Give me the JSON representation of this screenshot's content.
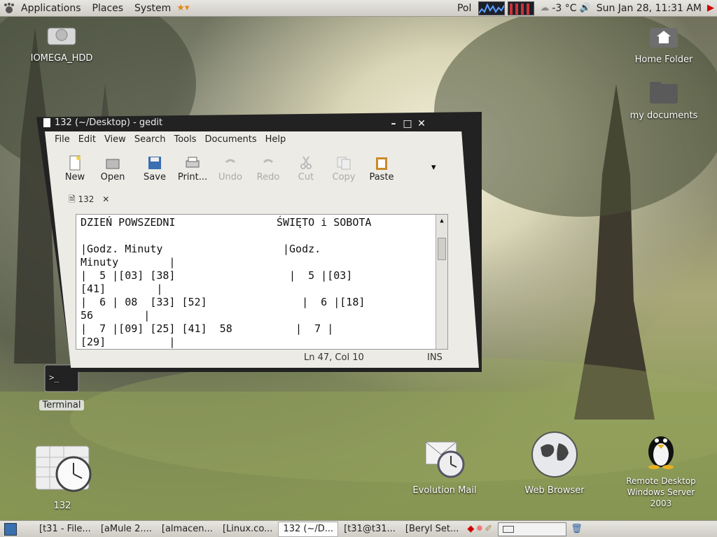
{
  "top_panel": {
    "menus": [
      "Applications",
      "Places",
      "System"
    ],
    "keyboard_layout": "Pol",
    "weather": "-3 °C",
    "clock": "Sun Jan 28, 11:31 AM"
  },
  "desktop_icons": {
    "iomega": "IOMEGA_HDD",
    "home": "Home Folder",
    "mydocs": "my documents",
    "terminal": "Terminal",
    "calendar": "132",
    "evolution": "Evolution Mail",
    "browser": "Web Browser",
    "rdp": "Remote Desktop Windows Server 2003"
  },
  "gedit": {
    "title": "132 (~/Desktop) - gedit",
    "menu": [
      "File",
      "Edit",
      "View",
      "Search",
      "Tools",
      "Documents",
      "Help"
    ],
    "toolbar": {
      "new": "New",
      "open": "Open",
      "save": "Save",
      "print": "Print...",
      "undo": "Undo",
      "redo": "Redo",
      "cut": "Cut",
      "copy": "Copy",
      "paste": "Paste"
    },
    "tab": "132",
    "content": "DZIEŃ POWSZEDNI                ŚWIĘTO i SOBOTA\n\n|Godz. Minuty                   |Godz.\nMinuty        |\n|  5 |[03] [38]                  |  5 |[03]\n[41]        |\n|  6 | 08  [33] [52]               |  6 |[18]\n56        |\n|  7 |[09] [25] [41]  58          |  7 |\n[29]          |",
    "status_pos": "Ln 47, Col 10",
    "status_mode": "INS"
  },
  "taskbar": {
    "tasks": [
      "[t31 - File...",
      "[aMule 2....",
      "[almacen...",
      "[Linux.co...",
      "132 (~/D...",
      "[t31@t31...",
      "[Beryl Set..."
    ]
  },
  "colors": {
    "panel": "#dcdad5",
    "accent": "#3a6fb0"
  }
}
